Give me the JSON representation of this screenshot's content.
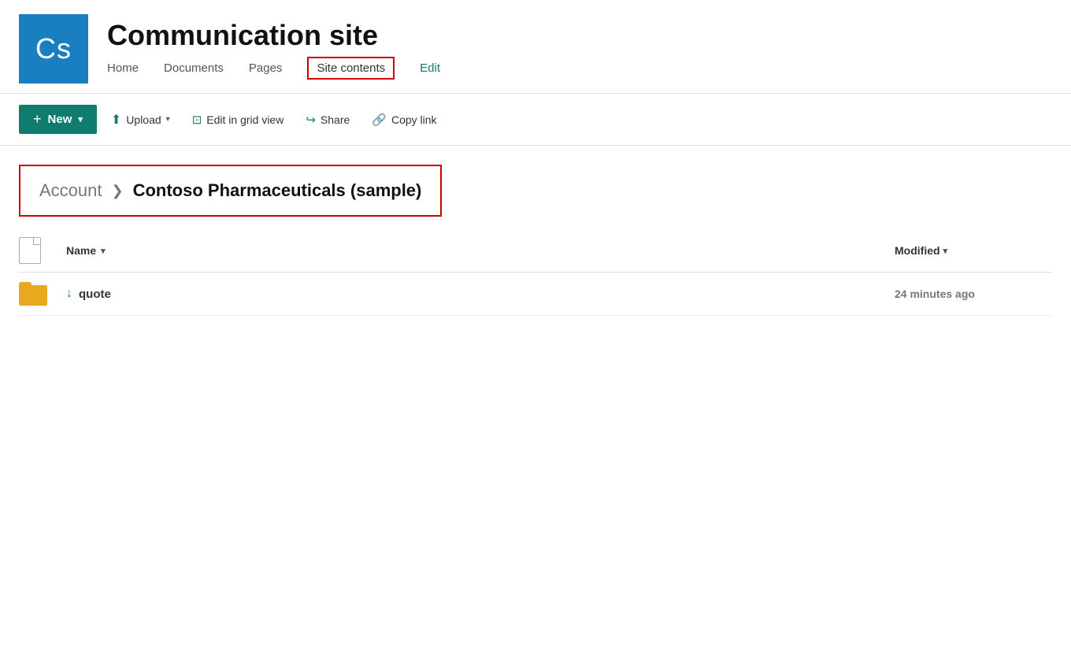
{
  "header": {
    "logo_text": "Cs",
    "site_title": "Communication site",
    "nav_items": [
      {
        "label": "Home",
        "active": false,
        "highlighted": false,
        "edit": false
      },
      {
        "label": "Documents",
        "active": false,
        "highlighted": false,
        "edit": false
      },
      {
        "label": "Pages",
        "active": false,
        "highlighted": false,
        "edit": false
      },
      {
        "label": "Site contents",
        "active": true,
        "highlighted": true,
        "edit": false
      },
      {
        "label": "Edit",
        "active": false,
        "highlighted": false,
        "edit": true
      }
    ]
  },
  "toolbar": {
    "new_label": "New",
    "upload_label": "Upload",
    "edit_grid_label": "Edit in grid view",
    "share_label": "Share",
    "copy_link_label": "Copy link"
  },
  "breadcrumb": {
    "parent": "Account",
    "current": "Contoso Pharmaceuticals (sample)"
  },
  "file_list": {
    "col_name_label": "Name",
    "col_modified_label": "Modified",
    "files": [
      {
        "type": "folder",
        "name": "quote",
        "modified": "24 minutes ago",
        "syncing": true
      }
    ]
  },
  "colors": {
    "teal": "#107c6e",
    "blue": "#1a7fc1",
    "red_highlight": "#cc0000",
    "folder_yellow": "#e8a820"
  }
}
